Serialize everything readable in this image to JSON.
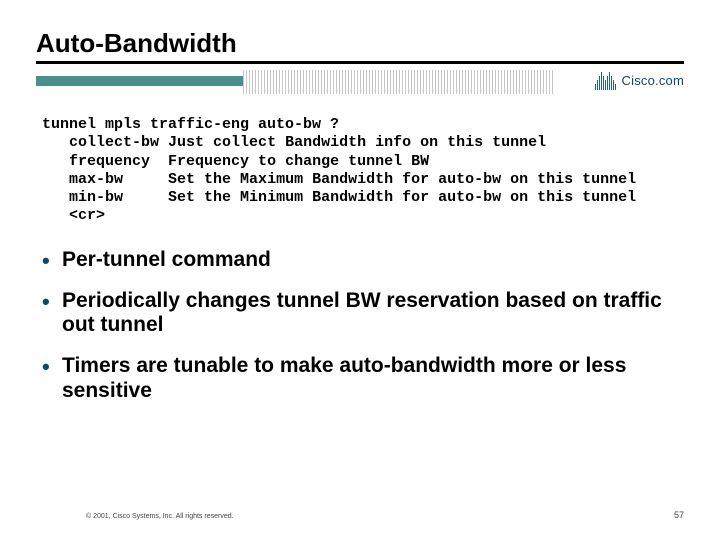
{
  "title": "Auto-Bandwidth",
  "branding": {
    "logotext": "Cisco.com"
  },
  "cli": {
    "cmd": "tunnel mpls traffic-eng auto-bw ?",
    "rows": [
      {
        "opt": "collect-bw",
        "desc": "Just collect Bandwidth info on this tunnel"
      },
      {
        "opt": "frequency",
        "desc": "Frequency to change tunnel BW"
      },
      {
        "opt": "max-bw",
        "desc": "Set the Maximum Bandwidth for auto-bw on this tunnel"
      },
      {
        "opt": "min-bw",
        "desc": "Set the Minimum Bandwidth for auto-bw on this tunnel"
      },
      {
        "opt": "<cr>",
        "desc": ""
      }
    ]
  },
  "bullets": [
    "Per-tunnel command",
    "Periodically changes tunnel BW reservation based on traffic out tunnel",
    "Timers are tunable to make auto-bandwidth more or less sensitive"
  ],
  "footer": {
    "copyright": "© 2001, Cisco Systems, Inc. All rights reserved.",
    "page": "57"
  }
}
